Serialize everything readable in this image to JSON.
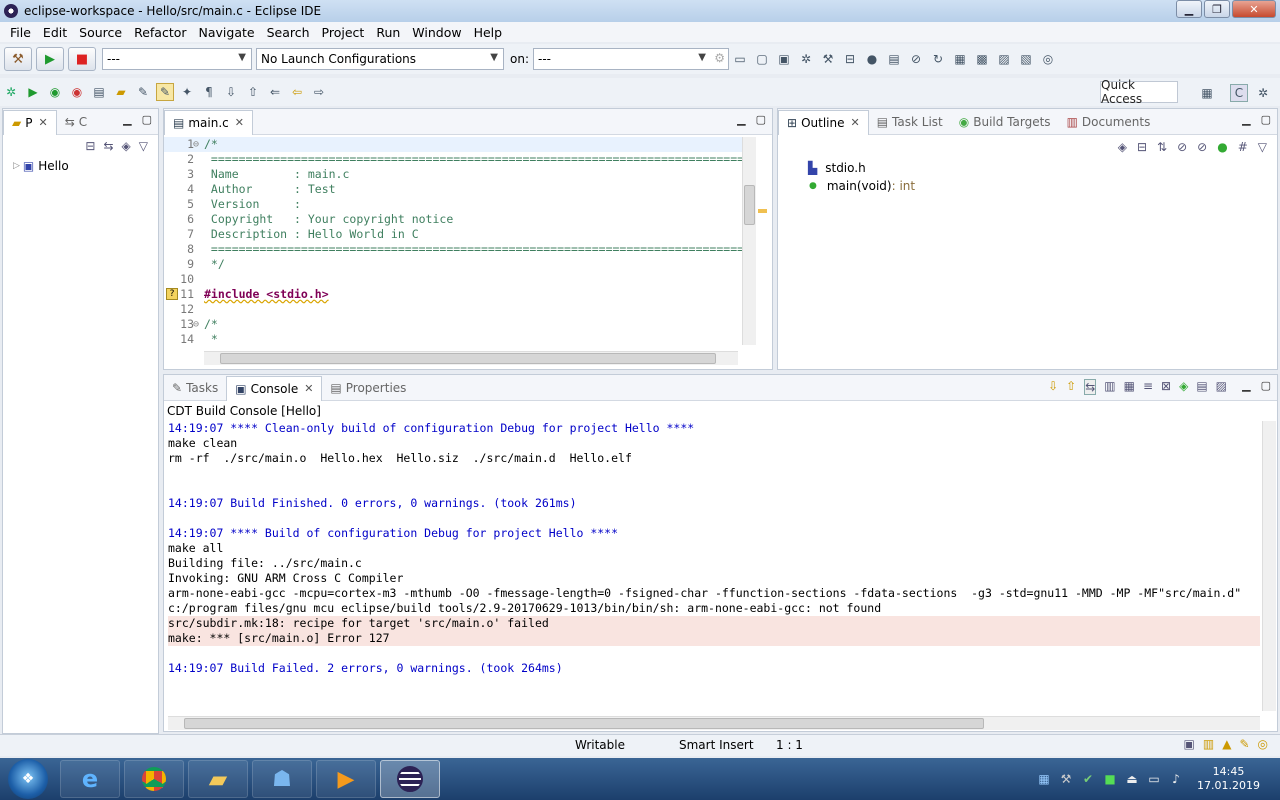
{
  "window": {
    "title": "eclipse-workspace - Hello/src/main.c - Eclipse IDE"
  },
  "menu": [
    "File",
    "Edit",
    "Source",
    "Refactor",
    "Navigate",
    "Search",
    "Project",
    "Run",
    "Window",
    "Help"
  ],
  "toolbar": {
    "launch_mode": "---",
    "launch_config": "No Launch Configurations",
    "on_label": "on:",
    "launch_target": "---",
    "quick_access": "Quick Access"
  },
  "project_explorer": {
    "tabs": [
      {
        "label": "P"
      },
      {
        "label": "C"
      }
    ],
    "tree": [
      {
        "label": "Hello"
      }
    ]
  },
  "editor": {
    "tab_label": "main.c",
    "lines": [
      {
        "n": "1",
        "text": "/*",
        "cls": "comment",
        "fold": "⊖"
      },
      {
        "n": "2",
        "text": " ==============================================================================",
        "cls": "comment"
      },
      {
        "n": "3",
        "text": " Name        : main.c",
        "cls": "comment"
      },
      {
        "n": "4",
        "text": " Author      : Test",
        "cls": "comment"
      },
      {
        "n": "5",
        "text": " Version     :",
        "cls": "comment"
      },
      {
        "n": "6",
        "text": " Copyright   : Your copyright notice",
        "cls": "comment"
      },
      {
        "n": "7",
        "text": " Description : Hello World in C",
        "cls": "comment"
      },
      {
        "n": "8",
        "text": " ==============================================================================",
        "cls": "comment"
      },
      {
        "n": "9",
        "text": " */",
        "cls": "comment"
      },
      {
        "n": "10",
        "text": "",
        "cls": ""
      },
      {
        "n": "11",
        "text": "#include <stdio.h>",
        "cls": "kw",
        "warn": "?"
      },
      {
        "n": "12",
        "text": "",
        "cls": ""
      },
      {
        "n": "13",
        "text": "/*",
        "cls": "comment",
        "fold": "⊖"
      },
      {
        "n": "14",
        "text": " *",
        "cls": "comment"
      }
    ]
  },
  "outline": {
    "tabs": [
      {
        "label": "Outline"
      },
      {
        "label": "Task List"
      },
      {
        "label": "Build Targets"
      },
      {
        "label": "Documents"
      }
    ],
    "items": [
      {
        "label": "stdio.h",
        "type": ""
      },
      {
        "label": "main(void)",
        "type": " : int"
      }
    ]
  },
  "bottom": {
    "tabs": [
      {
        "label": "Tasks"
      },
      {
        "label": "Console"
      },
      {
        "label": "Properties"
      }
    ],
    "console_title": "CDT Build Console [Hello]",
    "lines": [
      {
        "text": "14:19:07 **** Clean-only build of configuration Debug for project Hello ****",
        "cls": "blue"
      },
      {
        "text": "make clean",
        "cls": ""
      },
      {
        "text": "rm -rf  ./src/main.o  Hello.hex  Hello.siz  ./src/main.d  Hello.elf",
        "cls": ""
      },
      {
        "text": "",
        "cls": ""
      },
      {
        "text": "",
        "cls": ""
      },
      {
        "text": "14:19:07 Build Finished. 0 errors, 0 warnings. (took 261ms)",
        "cls": "blue"
      },
      {
        "text": "",
        "cls": ""
      },
      {
        "text": "14:19:07 **** Build of configuration Debug for project Hello ****",
        "cls": "blue"
      },
      {
        "text": "make all",
        "cls": ""
      },
      {
        "text": "Building file: ../src/main.c",
        "cls": ""
      },
      {
        "text": "Invoking: GNU ARM Cross C Compiler",
        "cls": ""
      },
      {
        "text": "arm-none-eabi-gcc -mcpu=cortex-m3 -mthumb -O0 -fmessage-length=0 -fsigned-char -ffunction-sections -fdata-sections  -g3 -std=gnu11 -MMD -MP -MF\"src/main.d\"",
        "cls": ""
      },
      {
        "text": "c:/program files/gnu mcu eclipse/build tools/2.9-20170629-1013/bin/bin/sh: arm-none-eabi-gcc: not found",
        "cls": ""
      },
      {
        "text": "src/subdir.mk:18: recipe for target 'src/main.o' failed",
        "cls": "err"
      },
      {
        "text": "make: *** [src/main.o] Error 127",
        "cls": "err"
      },
      {
        "text": "",
        "cls": ""
      },
      {
        "text": "14:19:07 Build Failed. 2 errors, 0 warnings. (took 264ms)",
        "cls": "blue"
      }
    ]
  },
  "status": {
    "writable": "Writable",
    "insert_mode": "Smart Insert",
    "position": "1 : 1"
  },
  "taskbar": {
    "time": "14:45",
    "date": "17.01.2019"
  },
  "colors": {
    "comment": "#3f7f5f",
    "keyword": "#7f0055",
    "console_info": "#0000c8",
    "error_bg": "#f9e4e0"
  }
}
